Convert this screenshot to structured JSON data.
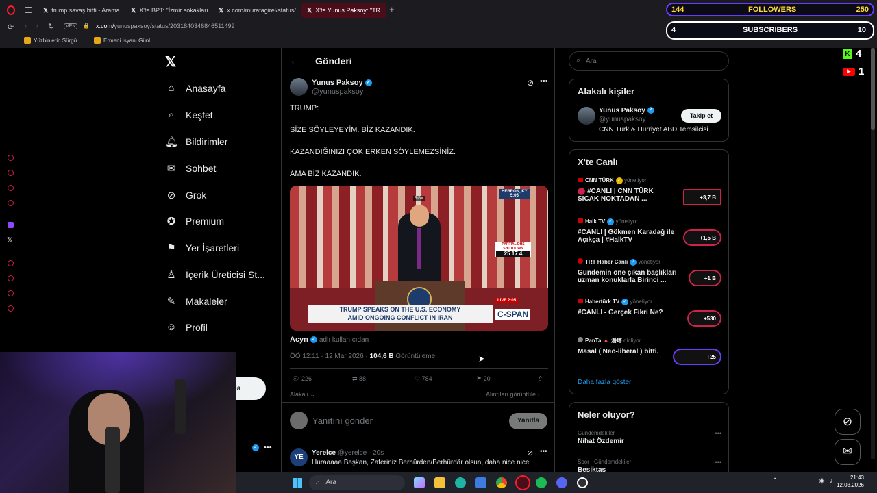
{
  "browser": {
    "tabs": [
      {
        "label": "trump savaş bitti - Arama"
      },
      {
        "label": "X'te BPT: \"İzmir sokakları"
      },
      {
        "label": "x.com/muratagirel/status/"
      },
      {
        "label": "X'te Yunus Paksoy: \"TR"
      }
    ],
    "vpn_label": "VPN",
    "url_host": "x.com/",
    "url_path": "yunuspaksoy/status/2031840346846511499",
    "bookmarks": [
      "Yüzbinlerin Sürgü...",
      "Ermeni İsyanı Günl..."
    ]
  },
  "stream_overlay": {
    "followers_current": "144",
    "followers_label": "FOLLOWERS",
    "followers_goal": "250",
    "subs_current": "4",
    "subs_label": "SUBSCRIBERS",
    "subs_goal": "10",
    "kick_count": "4",
    "youtube_count": "1"
  },
  "x_nav": {
    "items": [
      {
        "label": "Anasayfa",
        "icon": "home-icon"
      },
      {
        "label": "Keşfet",
        "icon": "search-icon"
      },
      {
        "label": "Bildirimler",
        "icon": "bell-icon"
      },
      {
        "label": "Sohbet",
        "icon": "mail-icon"
      },
      {
        "label": "Grok",
        "icon": "grok-icon"
      },
      {
        "label": "Premium",
        "icon": "premium-icon"
      },
      {
        "label": "Yer İşaretleri",
        "icon": "bookmark-icon"
      },
      {
        "label": "İçerik Üreticisi St...",
        "icon": "creator-icon"
      },
      {
        "label": "Makaleler",
        "icon": "article-icon"
      },
      {
        "label": "Profil",
        "icon": "profile-icon"
      }
    ],
    "post_button_partial": "la"
  },
  "post": {
    "header_title": "Gönderi",
    "author_name": "Yunus Paksoy",
    "author_handle": "@yunuspaksoy",
    "lines": [
      "TRUMP:",
      "SİZE SÖYLEYEYİM. BİZ KAZANDIK.",
      "KAZANDIĞINIZI ÇOK ERKEN SÖYLEMEZSİNİZ.",
      "AMA BİZ KAZANDIK."
    ],
    "video": {
      "chyron_line1": "TRUMP SPEAKS ON THE U.S. ECONOMY",
      "chyron_line2": "AMID ONGOING CONFLICT IN IRAN",
      "network": "C-SPAN",
      "location_tag": "HEBRON, KY",
      "time_tag": "5:05",
      "rgx_tag": "RGX",
      "countdown": "25 17 4",
      "countdown_label": "PARTIAL DHS SHUTDOWN",
      "live_tag": "LIVE",
      "live_time": "2:05"
    },
    "tagged_user": "Acyn",
    "tagged_suffix": "adlı kullanıcıdan",
    "time": "ÖÖ 12:11 · 12 Mar 2026 ·",
    "views": "104,6 B",
    "views_label": "Görüntüleme",
    "replies": "226",
    "reposts": "88",
    "likes": "784",
    "bookmarks": "20",
    "related_label": "Alakalı",
    "quotes_label": "Alıntıları görüntüle",
    "reply_placeholder": "Yanıtını gönder",
    "reply_button": "Yanıtla"
  },
  "reply": {
    "avatar_initials": "YE",
    "name": "Yerelce",
    "handle": "@yerelce",
    "age": "20s",
    "text": "Huraaaaa Başkan, Zaferiniz Berhürden/Berhürdâr olsun, daha nice nice"
  },
  "sidebar": {
    "search_placeholder": "Ara",
    "related_title": "Alakalı kişiler",
    "related_name": "Yunus Paksoy",
    "related_handle": "@yunuspaksoy",
    "related_bio": "CNN Türk & Hürriyet ABD Temsilcisi",
    "follow_button": "Takip et",
    "live_title": "X'te Canlı",
    "live_items": [
      {
        "source": "CNN TÜRK",
        "status": "yönetiyor",
        "title1": "#CANLI | CNN TÜRK",
        "title2": "SICAK NOKTADAN ...",
        "count": "+3,7 B"
      },
      {
        "source": "Halk TV",
        "status": "yönetiyor",
        "title1": "#CANLI | Gökmen Karadağ ile",
        "title2": "Açıkça | #HalkTV",
        "count": "+1,5 B"
      },
      {
        "source": "TRT Haber Canlı",
        "status": "yönetiyor",
        "title1": "Gündemin öne çıkan başlıkları",
        "title2": "uzman konuklarla Birinci ...",
        "count": "+1 B"
      },
      {
        "source": "Habertürk TV",
        "status": "yönetiyor",
        "title1": "#CANLI - Gerçek Fikri Ne?",
        "title2": "",
        "count": "+530"
      },
      {
        "source": "PanTa 🔺 潘塔",
        "status": "dinliyor",
        "title1": "Masal ( Neo-liberal ) bitti.",
        "title2": "",
        "count": "+25"
      }
    ],
    "show_more": "Daha fazla göster",
    "trends_title": "Neler oluyor?",
    "trend1_context": "Gündemdekiler",
    "trend1_name": "Nihat Özdemir",
    "trend2_context": "Spor · Gündemdekiler",
    "trend2_name": "Beşiktaş"
  },
  "taskbar": {
    "search_label": "Ara",
    "time": "21:43",
    "date": "12.03.2026"
  },
  "colors": {
    "accent": "#1d9bf0",
    "live_red": "#d0214a",
    "bg": "#000000"
  }
}
